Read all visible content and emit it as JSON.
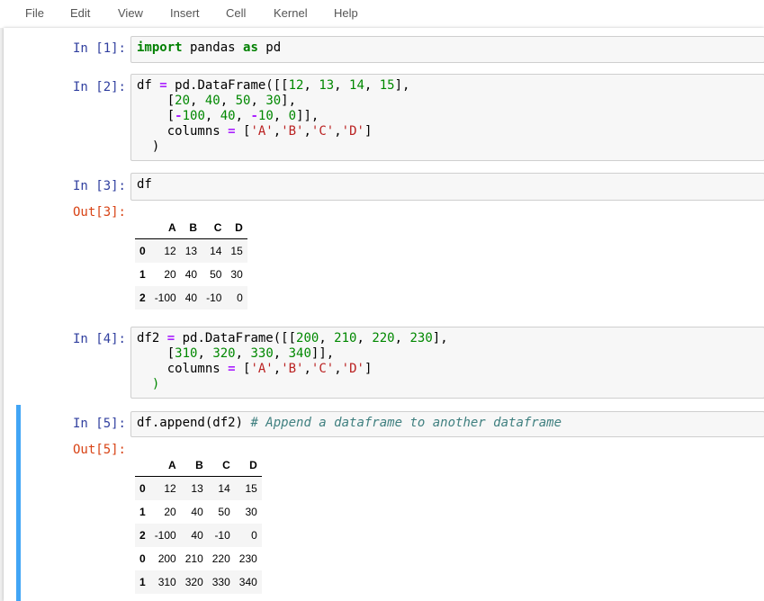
{
  "menu": {
    "items": [
      "File",
      "Edit",
      "View",
      "Insert",
      "Cell",
      "Kernel",
      "Help"
    ]
  },
  "cells": {
    "c1": {
      "prompt": "In [1]:"
    },
    "c2": {
      "prompt": "In [2]:"
    },
    "c3": {
      "prompt": "In [3]:",
      "out_prompt": "Out[3]:"
    },
    "c4": {
      "prompt": "In [4]:"
    },
    "c5": {
      "prompt": "In [5]:",
      "out_prompt": "Out[5]:"
    }
  },
  "tables": {
    "t1": {
      "columns": [
        "",
        "A",
        "B",
        "C",
        "D"
      ],
      "rows": [
        [
          "0",
          "12",
          "13",
          "14",
          "15"
        ],
        [
          "1",
          "20",
          "40",
          "50",
          "30"
        ],
        [
          "2",
          "-100",
          "40",
          "-10",
          "0"
        ]
      ]
    },
    "t2": {
      "columns": [
        "",
        "A",
        "B",
        "C",
        "D"
      ],
      "rows": [
        [
          "0",
          "12",
          "13",
          "14",
          "15"
        ],
        [
          "1",
          "20",
          "40",
          "50",
          "30"
        ],
        [
          "2",
          "-100",
          "40",
          "-10",
          "0"
        ],
        [
          "0",
          "200",
          "210",
          "220",
          "230"
        ],
        [
          "1",
          "310",
          "320",
          "330",
          "340"
        ]
      ]
    }
  },
  "colors": {
    "selected": "#42a5f5",
    "in_prompt": "#303f9f",
    "out_prompt": "#d84315"
  }
}
